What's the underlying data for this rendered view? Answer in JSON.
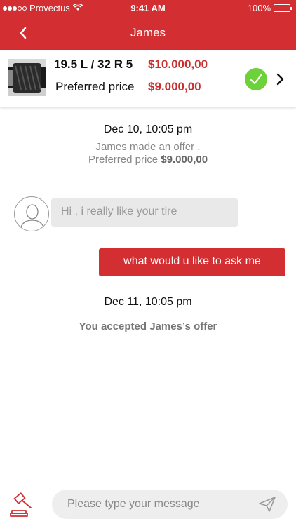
{
  "status_bar": {
    "carrier": "Provectus",
    "time": "9:41 AM",
    "battery": "100%",
    "battery_level": 1.0
  },
  "header": {
    "title": "James"
  },
  "product": {
    "size": "19.5 L / 32 R 5",
    "price": "$10.000,00",
    "preferred_label": "Preferred price",
    "preferred_price": "$9.000,00"
  },
  "thread": {
    "event1_date": "Dec 10, 10:05 pm",
    "event1_text": "James made an offer .",
    "event1_pref_label": "Preferred price",
    "event1_pref_value": "$9.000,00",
    "incoming_message": "Hi , i really like your tire",
    "outgoing_message": "what would u like to ask me",
    "event2_date": "Dec 11, 10:05 pm",
    "event2_text": "You accepted James’s offer"
  },
  "composer": {
    "placeholder": "Please type your message"
  },
  "colors": {
    "brand_red": "#d32f32",
    "price_red": "#c8302f",
    "accept_green": "#6dd13a"
  }
}
